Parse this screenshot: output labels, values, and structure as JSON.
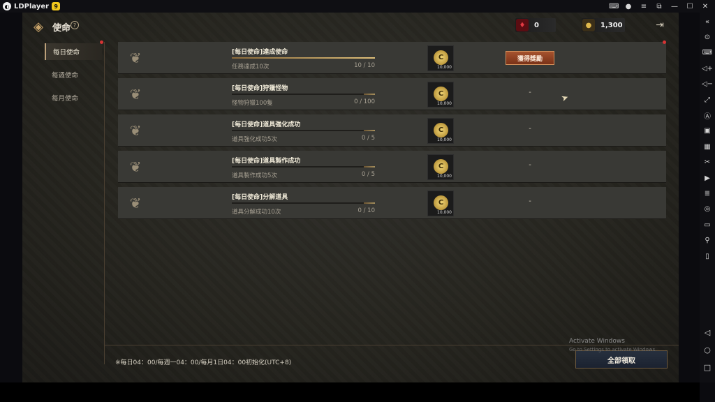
{
  "emulator": {
    "title": "LDPlayer",
    "badge": "9",
    "titlebar_icons": [
      "gamepad-icon",
      "account-icon",
      "menu-icon",
      "screen-icon",
      "minimize-icon",
      "maximize-icon",
      "close-icon"
    ],
    "titlebar_glyphs": [
      "⌨",
      "●",
      "≡",
      "⧉",
      "—",
      "☐",
      "✕"
    ],
    "sidebar_icons": [
      "collapse-icon",
      "settings-icon",
      "keyboard-icon",
      "volume-up-icon",
      "volume-down-icon",
      "resize-icon",
      "sync-icon",
      "screenshot-icon",
      "apk-icon",
      "cut-icon",
      "record-icon",
      "notes-icon",
      "rotate-icon",
      "folder-icon",
      "location-icon",
      "shake-icon"
    ],
    "sidebar_glyphs": [
      "«",
      "⊙",
      "⌨",
      "◁+",
      "◁−",
      "⤢",
      "Ⓐ",
      "▣",
      "▦",
      "✂",
      "▶",
      "≣",
      "◎",
      "▭",
      "⚲",
      "▯"
    ],
    "nav_icons": [
      "back-nav-icon",
      "home-nav-icon",
      "recents-nav-icon"
    ],
    "nav_glyphs": [
      "◁",
      "○",
      "□"
    ]
  },
  "game": {
    "title": "使命",
    "help": "?",
    "back_glyph": "◈",
    "gem_count": "0",
    "coin_count": "1,300",
    "exit_glyph": "⇥",
    "tabs": [
      {
        "label": "每日使命",
        "active": true
      },
      {
        "label": "每週使命",
        "active": false
      },
      {
        "label": "每月使命",
        "active": false
      }
    ],
    "missions": [
      {
        "title": "[每日使命]達成使命",
        "desc": "任務達成10次",
        "progress": "10 / 10",
        "fill": 1.0,
        "reward": "10,000",
        "status": "獲得獎勵",
        "claimable": true
      },
      {
        "title": "[每日使命]狩獵怪物",
        "desc": "怪物狩獵100隻",
        "progress": "0 / 100",
        "fill": 0.0,
        "reward": "10,000",
        "status": "-",
        "claimable": false
      },
      {
        "title": "[每日使命]道具強化成功",
        "desc": "道具強化成功5次",
        "progress": "0 / 5",
        "fill": 0.0,
        "reward": "10,000",
        "status": "-",
        "claimable": false
      },
      {
        "title": "[每日使命]道具製作成功",
        "desc": "道具製作成功5次",
        "progress": "0 / 5",
        "fill": 0.0,
        "reward": "10,000",
        "status": "-",
        "claimable": false
      },
      {
        "title": "[每日使命]分解道具",
        "desc": "道具分解成功10次",
        "progress": "0 / 10",
        "fill": 0.0,
        "reward": "10,000",
        "status": "-",
        "claimable": false
      }
    ],
    "reset_note": "※每日04：00/每週一04：00/每月1日04：00初始化(UTC+8)",
    "claim_all": "全部領取"
  },
  "watermark": {
    "line1": "Activate Windows",
    "line2": "Go to Settings to activate Windows."
  }
}
